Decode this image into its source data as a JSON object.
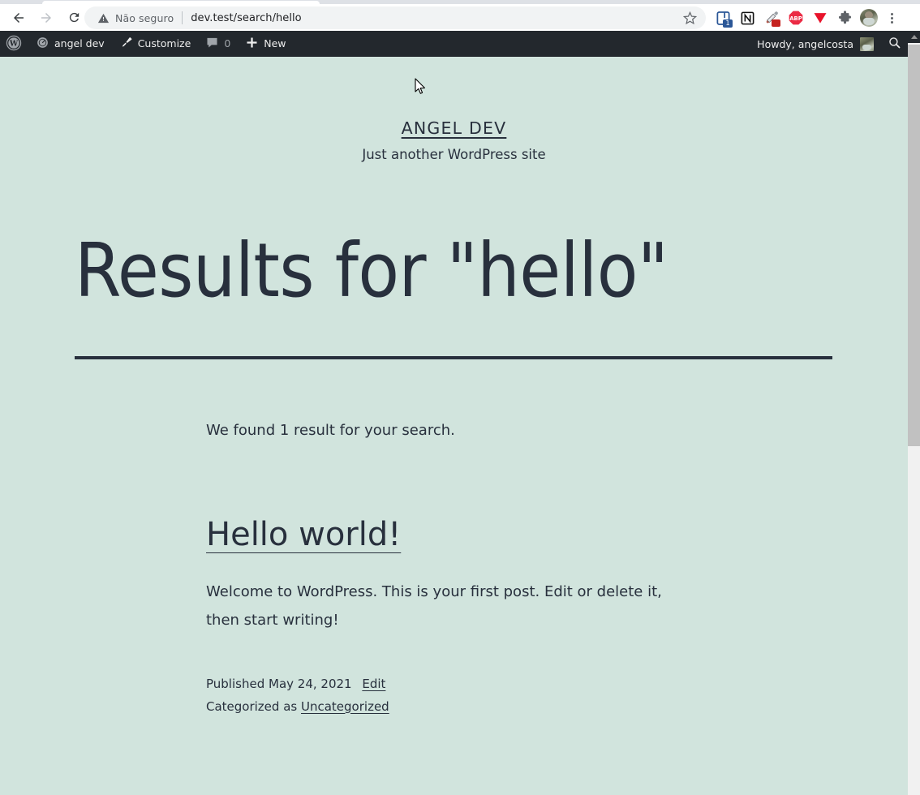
{
  "browser": {
    "back_label": "Back",
    "forward_label": "Forward",
    "reload_label": "Reload",
    "security": {
      "icon": "warning-triangle-icon",
      "label": "Não seguro"
    },
    "url": "dev.test/search/hello",
    "bookmark_label": "Bookmark this tab",
    "extensions": [
      {
        "name": "reading-list-extension-icon",
        "glyph": "clipboard",
        "badge": "1"
      },
      {
        "name": "notion-extension-icon",
        "glyph": "N",
        "badge": ""
      },
      {
        "name": "color-picker-extension-icon",
        "glyph": "eyedropper",
        "badge": "dot"
      },
      {
        "name": "adblock-plus-extension-icon",
        "glyph": "ABP",
        "badge": ""
      },
      {
        "name": "downloader-extension-icon",
        "glyph": "triangle-down",
        "badge": ""
      },
      {
        "name": "extensions-puzzle-icon",
        "glyph": "puzzle",
        "badge": ""
      }
    ],
    "profile_label": "Profile",
    "menu_label": "Customize and control Google Chrome"
  },
  "adminbar": {
    "logo_label": "About WordPress",
    "items": [
      {
        "name": "site-name",
        "icon": "dashboard-icon",
        "label": "angel dev"
      },
      {
        "name": "customize",
        "icon": "paintbrush-icon",
        "label": "Customize"
      },
      {
        "name": "comments",
        "icon": "comment-bubble-icon",
        "label": "0"
      },
      {
        "name": "new-content",
        "icon": "plus-icon",
        "label": "New"
      }
    ],
    "howdy": "Howdy, angelcosta",
    "avatar_label": "angelcosta avatar",
    "search_label": "Search"
  },
  "site": {
    "title": "ANGEL DEV",
    "description": "Just another WordPress site"
  },
  "search_results": {
    "page_title": "Results for \"hello\"",
    "found_text": "We found 1 result for your search.",
    "results": [
      {
        "title": "Hello world!",
        "excerpt": "Welcome to WordPress. This is your first post. Edit or delete it, then start writing!",
        "published_prefix": "Published",
        "published_date": "May 24, 2021",
        "edit_label": "Edit",
        "category_prefix": "Categorized as",
        "category": "Uncategorized"
      }
    ]
  },
  "colors": {
    "page_background": "#d1e4dd",
    "text": "#28303d",
    "adminbar_background": "#23282d",
    "browser_chrome": "#ffffff",
    "omnibox_background": "#f1f3f4"
  },
  "scrollbar": {
    "up_arrow_label": "Scroll up"
  }
}
